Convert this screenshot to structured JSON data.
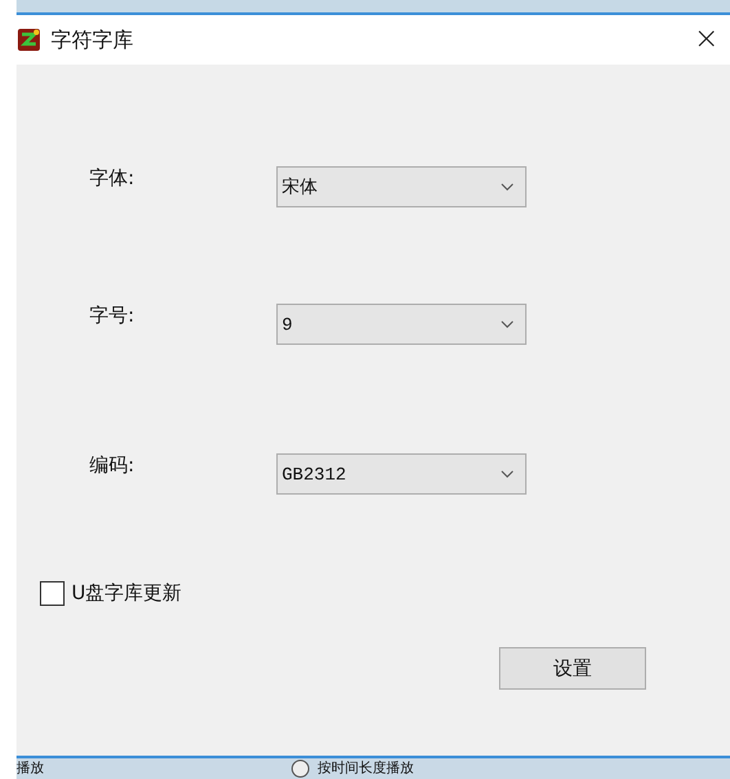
{
  "window": {
    "title": "字符字库",
    "close": "×"
  },
  "fields": [
    {
      "label": "字体:",
      "value": "宋体"
    },
    {
      "label": "字号:",
      "value": "9"
    },
    {
      "label": "编码:",
      "value": "GB2312"
    }
  ],
  "checkbox": {
    "label": "U盘字库更新",
    "checked": false
  },
  "button": "设置",
  "background_window": {
    "text": "播放",
    "radio": {
      "label": "按时间长度播放",
      "selected": false
    }
  }
}
